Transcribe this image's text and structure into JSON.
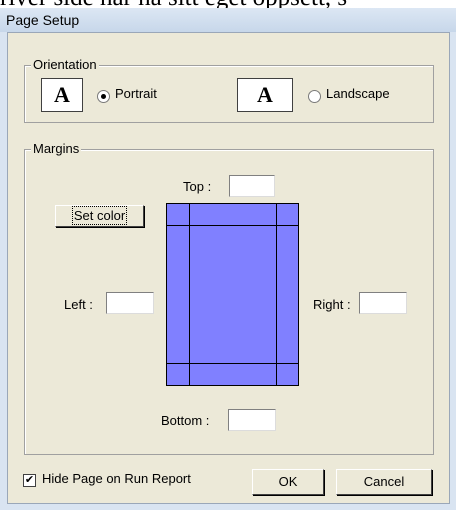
{
  "background_text": "river side har na sitt eget oppsett, s",
  "window": {
    "title": "Page Setup"
  },
  "orientation": {
    "group_label": "Orientation",
    "portrait": {
      "icon": "A",
      "label": "Portrait",
      "selected": true
    },
    "landscape": {
      "icon": "A",
      "label": "Landscape",
      "selected": false
    }
  },
  "margins": {
    "group_label": "Margins",
    "top_label": "Top :",
    "left_label": "Left :",
    "right_label": "Right :",
    "bottom_label": "Bottom :",
    "top_value": "",
    "left_value": "",
    "right_value": "",
    "bottom_value": "",
    "set_color_label": "Set color",
    "preview_color": "#8080ff"
  },
  "footer": {
    "hide_page_label": "Hide Page on Run Report",
    "hide_page_checked": true,
    "ok_label": "OK",
    "cancel_label": "Cancel"
  }
}
